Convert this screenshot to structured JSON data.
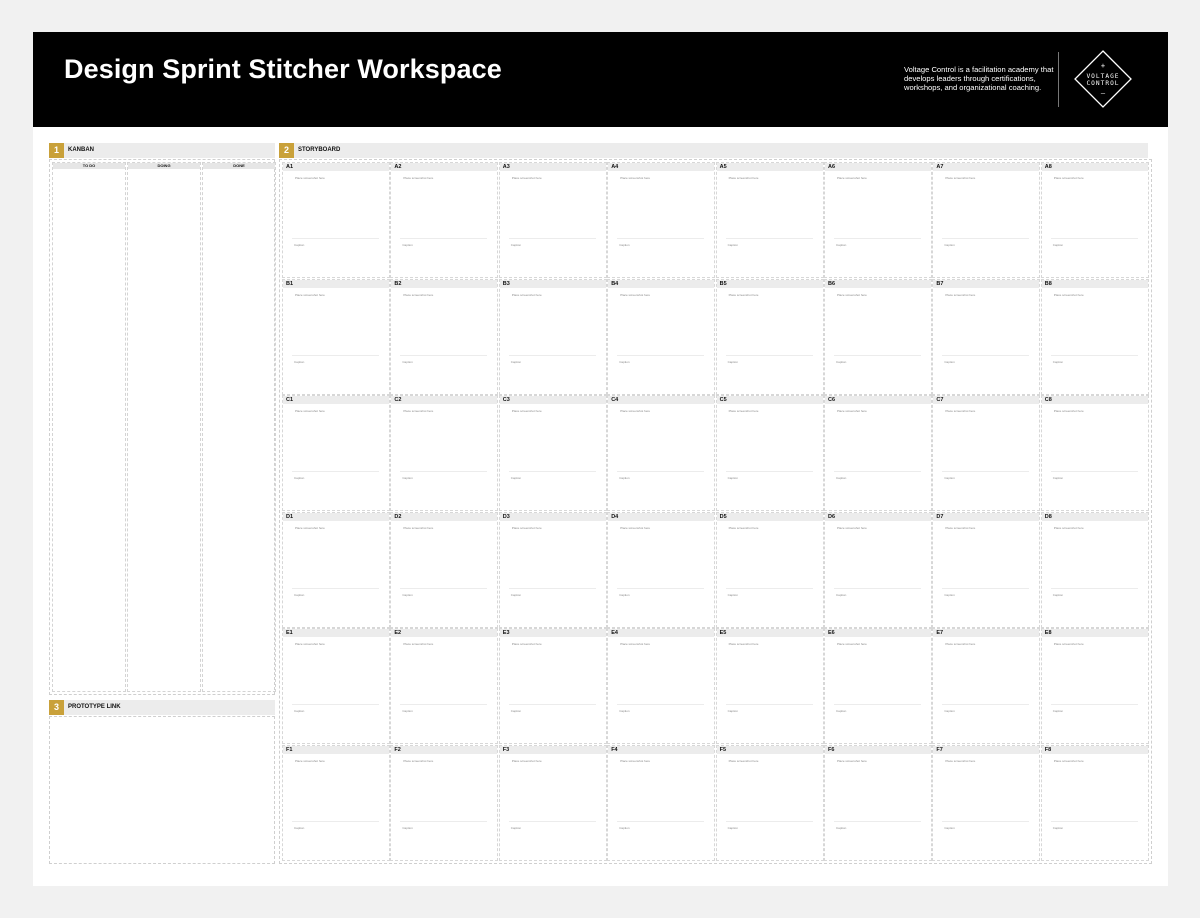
{
  "header": {
    "title": "Design Sprint Stitcher Workspace",
    "tagline": "Voltage Control is a facilitation academy that develops leaders through certifications, workshops, and organizational coaching.",
    "logo_line1": "VOLTAGE",
    "logo_line2": "CONTROL",
    "logo_plus": "+",
    "logo_minus": "–"
  },
  "colors": {
    "header_bg": "#000000",
    "accent": "#c9a13a",
    "section_bg": "#ececec"
  },
  "kanban": {
    "number": "1",
    "label": "KANBAN",
    "columns": [
      "TO DO",
      "DOING",
      "DONE"
    ]
  },
  "storyboard": {
    "number": "2",
    "label": "STORYBOARD",
    "rows": [
      "A",
      "B",
      "C",
      "D",
      "E",
      "F"
    ],
    "cols": 8,
    "frame_hint": "Place screenshot here",
    "frame_caption": "Caption"
  },
  "prototype": {
    "number": "3",
    "label": "PROTOTYPE LINK"
  }
}
